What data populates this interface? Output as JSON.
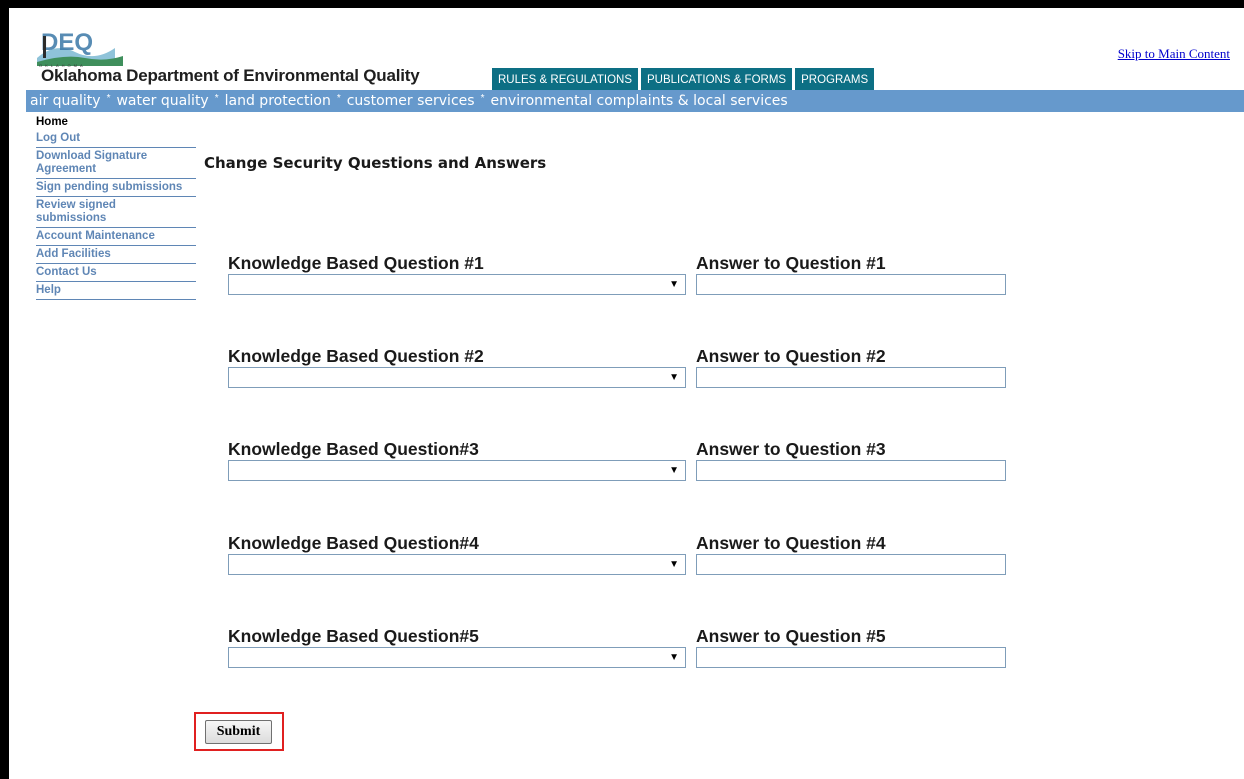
{
  "header": {
    "logo_icon": "deq-logo-icon",
    "agency_name": "Oklahoma Department of Environmental Quality",
    "skip_link": "Skip to Main Content",
    "tabs": [
      "RULES & REGULATIONS",
      "PUBLICATIONS & FORMS",
      "PROGRAMS"
    ],
    "tab_color": "#0d6f84"
  },
  "nav_bar": {
    "color": "#6699cc",
    "links": [
      "air quality",
      "water quality",
      "land protection",
      "customer services",
      "environmental complaints & local services"
    ],
    "separator": "*"
  },
  "sidebar": {
    "items": [
      "Home",
      "Log Out",
      "Download Signature Agreement",
      "Sign pending submissions",
      "Review signed submissions",
      "Account Maintenance",
      "Add Facilities",
      "Contact Us",
      "Help"
    ]
  },
  "main": {
    "title": "Change Security Questions and Answers",
    "questions": [
      {
        "question_label": "Knowledge Based Question #1",
        "answer_label": "Answer to Question #1",
        "selected": "",
        "answer": ""
      },
      {
        "question_label": "Knowledge Based Question #2",
        "answer_label": "Answer to Question #2",
        "selected": "",
        "answer": ""
      },
      {
        "question_label": "Knowledge Based Question#3",
        "answer_label": "Answer to Question #3",
        "selected": "",
        "answer": ""
      },
      {
        "question_label": "Knowledge Based Question#4",
        "answer_label": "Answer to Question #4",
        "selected": "",
        "answer": ""
      },
      {
        "question_label": "Knowledge Based Question#5",
        "answer_label": "Answer to Question #5",
        "selected": "",
        "answer": ""
      }
    ],
    "submit_label": "Submit",
    "highlight_color": "#e02020"
  }
}
